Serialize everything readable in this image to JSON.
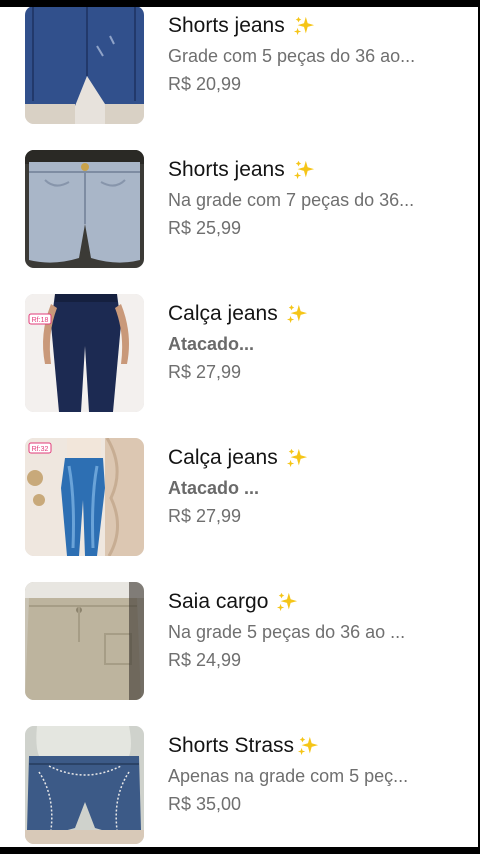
{
  "products": [
    {
      "title": "Shorts jeans",
      "description": "Grade com 5 peças do 36 ao...",
      "price": "R$ 20,99",
      "image": "denim-shorts-dark"
    },
    {
      "title": "Shorts jeans",
      "description": "Na grade com 7 peças do 36...",
      "price": "R$ 25,99",
      "image": "denim-shorts-light"
    },
    {
      "title": "Calça jeans",
      "description": "Atacado...",
      "price": "R$ 27,99",
      "image": "dark-skinny-jeans",
      "badge": "Rf:18"
    },
    {
      "title": "Calça jeans",
      "description": "Atacado ...",
      "price": "R$ 27,99",
      "image": "blue-skinny-jeans",
      "badge": "Rf:32"
    },
    {
      "title": "Saia cargo",
      "description": "Na grade 5 peças do 36 ao ...",
      "price": "R$ 24,99",
      "image": "beige-cargo-skirt"
    },
    {
      "title": "Shorts Strass",
      "description": "Apenas na grade com 5 peç...",
      "price": "R$ 35,00",
      "image": "rhinestone-denim-shorts"
    }
  ],
  "icons": {
    "sparkle": "sparkles-emoji-icon"
  },
  "colors": {
    "sparkle": "#f5c518",
    "text": "#141414",
    "muted": "#6f6f6f"
  }
}
